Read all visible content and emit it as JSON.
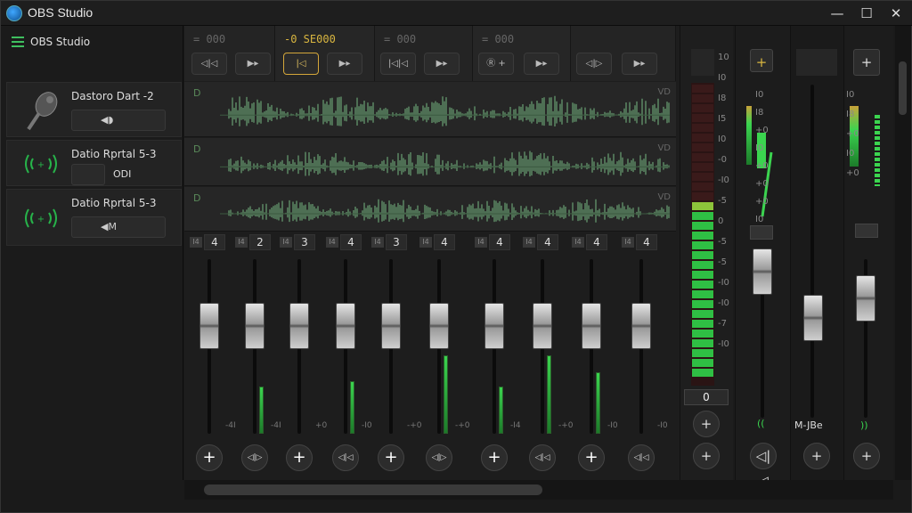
{
  "window": {
    "title": "OBS Studio",
    "min": "—",
    "max": "☐",
    "close": "✕"
  },
  "left": {
    "header": "OBS Studio",
    "sources": [
      {
        "name": "Dastoro Dart -2",
        "button": "◀◗",
        "icon": "microphone-icon"
      },
      {
        "name": "Datio Rprtal 5-3",
        "button_value": "ODI",
        "icon": "audio-wave-icon"
      },
      {
        "name": "Datio Rprtal 5-3",
        "button": "◀M",
        "icon": "audio-wave-icon"
      }
    ]
  },
  "strips": [
    {
      "title": "= 000",
      "btn1": "◁|◁",
      "btn2": "▶▸",
      "active": false
    },
    {
      "title": "-0 SE000",
      "btn1": "|◁",
      "btn2": "▶▸",
      "active": true
    },
    {
      "title": "= 000",
      "btn1": "|◁|◁",
      "btn2": "▶▸",
      "active": false
    },
    {
      "title": "= 000",
      "btn1": "Ⓡ +",
      "btn2": "▶▸",
      "active": false
    },
    {
      "title": "",
      "btn1": "◁|▷",
      "btn2": "▶▸",
      "active": false
    }
  ],
  "wave_rows": [
    {
      "label": "D",
      "right": "VD"
    },
    {
      "label": "D",
      "right": "VD"
    },
    {
      "label": "D",
      "right": "VD"
    }
  ],
  "channels": [
    {
      "num": "4",
      "chip": "I4",
      "level": 0.0,
      "knob": 0.28,
      "meter": 0.0,
      "mlabel": "-4I"
    },
    {
      "num": "2",
      "chip": "I4",
      "level": 0.27,
      "knob": 0.28,
      "meter": 0.27,
      "mlabel": "-4I"
    },
    {
      "num": "3",
      "chip": "I4",
      "level": 0.0,
      "knob": 0.28,
      "meter": 0.0,
      "mlabel": "+0"
    },
    {
      "num": "4",
      "chip": "I4",
      "level": 0.3,
      "knob": 0.28,
      "meter": 0.3,
      "mlabel": "-I0"
    },
    {
      "num": "3",
      "chip": "I4",
      "level": 0.0,
      "knob": 0.28,
      "meter": 0.0,
      "mlabel": "-+0"
    },
    {
      "num": "4",
      "chip": "I4",
      "level": 0.45,
      "knob": 0.28,
      "meter": 0.45,
      "mlabel": "-+0"
    },
    {
      "num": "4",
      "chip": "I4",
      "level": 0.27,
      "knob": 0.28,
      "meter": 0.27,
      "mlabel": "-I4"
    },
    {
      "num": "4",
      "chip": "I4",
      "level": 0.45,
      "knob": 0.28,
      "meter": 0.45,
      "mlabel": "-+0"
    },
    {
      "num": "4",
      "chip": "I4",
      "level": 0.35,
      "knob": 0.28,
      "meter": 0.35,
      "mlabel": "-I0"
    },
    {
      "num": "4",
      "chip": "I4",
      "level": 0.0,
      "knob": 0.28,
      "meter": 0.0,
      "mlabel": "-I0"
    }
  ],
  "master": {
    "scale": [
      "10",
      "I0",
      "I8",
      "I5",
      "I0",
      "-0",
      "-I0",
      "-5",
      "0",
      "-5",
      "-5",
      "-I0",
      "-I0",
      "-7",
      "-I0"
    ],
    "value": "0",
    "meter_level": 0.6
  },
  "aux": [
    {
      "add": "+",
      "scale": [
        "I0",
        "I8",
        "+0",
        "I0",
        "+0",
        "+0",
        "+0",
        "I0",
        "-0",
        "-I0",
        "-+0"
      ],
      "footer": "((",
      "level": 0.3
    },
    {
      "add": "",
      "scale": [],
      "footer": "M-JBe",
      "level": 0.0
    },
    {
      "add": "+",
      "scale": [
        "I0",
        "I8",
        "+0",
        "I0",
        "+0"
      ],
      "footer": "))",
      "level": 0.25
    }
  ],
  "bottom_buttons": [
    "+",
    "◁|▷",
    "+",
    "◁|◁",
    "+",
    "◁|▷",
    "+",
    "◁|◁",
    "+",
    "◁|◁"
  ]
}
